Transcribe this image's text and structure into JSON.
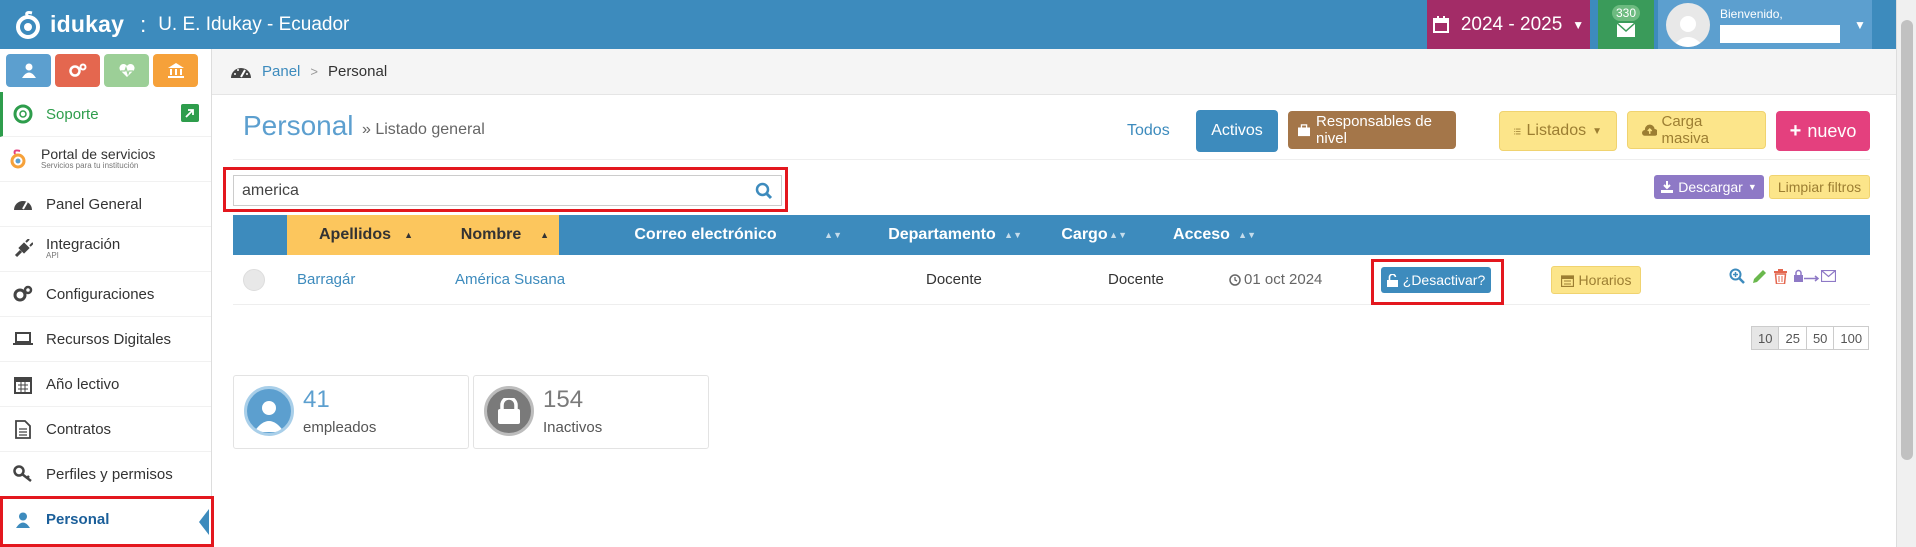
{
  "app": {
    "logo_text": "idukay",
    "separator": ":",
    "school_name": "U. E. Idukay - Ecuador"
  },
  "topbar": {
    "year": "2024 - 2025",
    "mail_count": "330",
    "welcome": "Bienvenido,",
    "colors": {
      "bar": "#3d8bbd",
      "year": "#a32c67",
      "mail": "#3a9b5a",
      "user": "#5c9fcf"
    }
  },
  "quick_buttons": [
    {
      "name": "user-icon",
      "color": "#5c9fcf"
    },
    {
      "name": "gears-icon",
      "color": "#e4674f"
    },
    {
      "name": "heartbeat-icon",
      "color": "#9ccf97"
    },
    {
      "name": "bank-icon",
      "color": "#f6a13a"
    }
  ],
  "sidebar": {
    "items": [
      {
        "label": "Soporte",
        "sub": ""
      },
      {
        "label": "Portal de servicios",
        "sub": "Servicios para tu institución"
      },
      {
        "label": "Panel General",
        "sub": ""
      },
      {
        "label": "Integración",
        "sub": "API"
      },
      {
        "label": "Configuraciones",
        "sub": ""
      },
      {
        "label": "Recursos Digitales",
        "sub": ""
      },
      {
        "label": "Año lectivo",
        "sub": ""
      },
      {
        "label": "Contratos",
        "sub": ""
      },
      {
        "label": "Perfiles y permisos",
        "sub": ""
      },
      {
        "label": "Personal",
        "sub": ""
      }
    ]
  },
  "breadcrumb": {
    "panel": "Panel",
    "sep": ">",
    "current": "Personal"
  },
  "page": {
    "title": "Personal",
    "subtitle": "» Listado general"
  },
  "actions": {
    "todos": "Todos",
    "activos": "Activos",
    "responsables": "Responsables de nivel",
    "listados": "Listados",
    "carga": "Carga masiva",
    "nuevo": "nuevo"
  },
  "search": {
    "value": "america"
  },
  "tools": {
    "descargar": "Descargar",
    "limpiar": "Limpiar filtros"
  },
  "table": {
    "headers": [
      "Apellidos",
      "Nombre",
      "Correo electrónico",
      "Departamento",
      "Cargo",
      "Acceso"
    ],
    "row": {
      "apellidos": "Barragár",
      "nombre": "América Susana",
      "correo": "",
      "departamento": "Docente",
      "cargo": "Docente",
      "acceso": "01 oct 2024",
      "desactivar": "¿Desactivar?",
      "horarios": "Horarios"
    }
  },
  "page_sizes": [
    "10",
    "25",
    "50",
    "100"
  ],
  "cards": [
    {
      "number": "41",
      "label": "empleados",
      "color": "#5c9fcf"
    },
    {
      "number": "154",
      "label": "Inactivos",
      "color": "#7a7a7a"
    }
  ]
}
